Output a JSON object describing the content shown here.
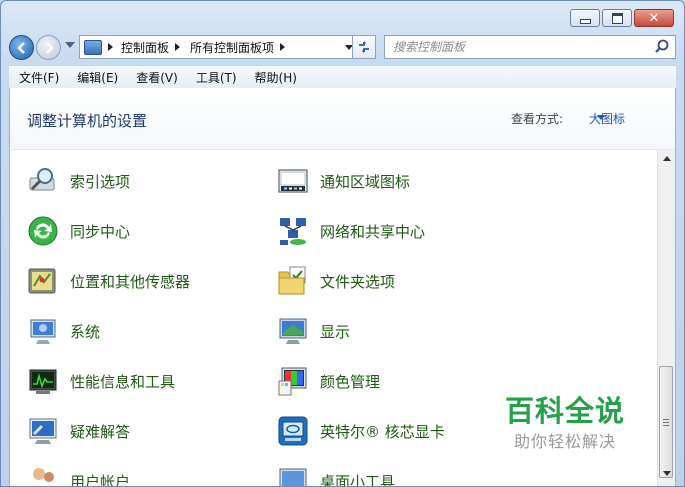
{
  "nav": {
    "breadcrumb": [
      "控制面板",
      "所有控制面板项"
    ],
    "search_placeholder": "搜索控制面板"
  },
  "menu": [
    "文件(F)",
    "编辑(E)",
    "查看(V)",
    "工具(T)",
    "帮助(H)"
  ],
  "header": {
    "title": "调整计算机的设置",
    "view_by_label": "查看方式:",
    "view_by_value": "大图标"
  },
  "items": {
    "left": [
      {
        "label": "索引选项",
        "icon": "magnifier-index-icon"
      },
      {
        "label": "同步中心",
        "icon": "sync-center-icon"
      },
      {
        "label": "位置和其他传感器",
        "icon": "location-sensors-icon"
      },
      {
        "label": "系统",
        "icon": "system-monitor-icon"
      },
      {
        "label": "性能信息和工具",
        "icon": "performance-icon"
      },
      {
        "label": "疑难解答",
        "icon": "troubleshoot-icon"
      },
      {
        "label": "用户帐户",
        "icon": "user-accounts-icon"
      }
    ],
    "right": [
      {
        "label": "通知区域图标",
        "icon": "notification-area-icon"
      },
      {
        "label": "网络和共享中心",
        "icon": "network-sharing-icon"
      },
      {
        "label": "文件夹选项",
        "icon": "folder-options-icon"
      },
      {
        "label": "显示",
        "icon": "display-icon"
      },
      {
        "label": "颜色管理",
        "icon": "color-management-icon"
      },
      {
        "label": "英特尔® 核芯显卡",
        "icon": "intel-graphics-icon"
      },
      {
        "label": "桌面小工具",
        "icon": "desktop-gadgets-icon"
      }
    ]
  },
  "watermark": {
    "main": "百科全说",
    "sub": "助你轻松解决"
  }
}
